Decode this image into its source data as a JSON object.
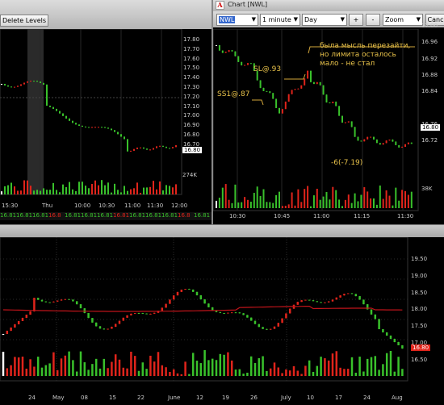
{
  "left_window": {
    "delete_levels_label": "Delete Levels",
    "price_ticks": [
      "17.80",
      "17.70",
      "17.60",
      "17.50",
      "17.40",
      "17.30",
      "17.20",
      "17.10",
      "17.00",
      "16.90",
      "16.80",
      "16.70",
      "16.80"
    ],
    "current_price": "16.80",
    "volume_label": "274K",
    "time_ticks": [
      "15:30",
      "Thu",
      "10:00",
      "10:30",
      "11:00",
      "11:30",
      "12:00"
    ],
    "tape": [
      "16.81",
      "16.81",
      "16.81",
      "16.8",
      "16.81",
      "16.81",
      "16.81",
      "16.81",
      "16.81",
      "16.81",
      "16.81",
      "16.8",
      "16.81"
    ]
  },
  "right_window": {
    "title": "Chart [NWL]",
    "symbol": "NWL",
    "interval": "1 minute",
    "range": "Day",
    "plus_label": "+",
    "minus_label": "-",
    "zoom_label": "Zoom",
    "cancel_label": "Canc",
    "price_ticks": [
      "17.00",
      "16.96",
      "16.92",
      "16.88",
      "16.84",
      "16.80",
      "16.76",
      "16.72"
    ],
    "current_price": "16.80",
    "volume_label": "38K",
    "time_ticks": [
      "10:30",
      "10:45",
      "11:00",
      "11:15",
      "11:30"
    ],
    "annotations": {
      "ss1": "SS1@.87",
      "sl": "SL@.93",
      "thought": [
        "была мысль перезайти,",
        "но лимита осталось",
        "мало - не стал"
      ],
      "result": "-6(-7.19)"
    }
  },
  "daily_chart": {
    "price_ticks": [
      "19.50",
      "19.00",
      "18.50",
      "18.00",
      "17.50",
      "17.00",
      "16.50"
    ],
    "current_price": "16.80",
    "date_ticks": [
      "24",
      "May",
      "08",
      "15",
      "22",
      "June",
      "12",
      "19",
      "26",
      "July",
      "10",
      "17",
      "24",
      "Aug"
    ]
  },
  "colors": {
    "up": "#39c12b",
    "down": "#e0241b",
    "neutral": "#ffffff",
    "ma": "#c0141a",
    "price_tag_bg": "#ffffff",
    "daily_tag": "#e0241b"
  }
}
